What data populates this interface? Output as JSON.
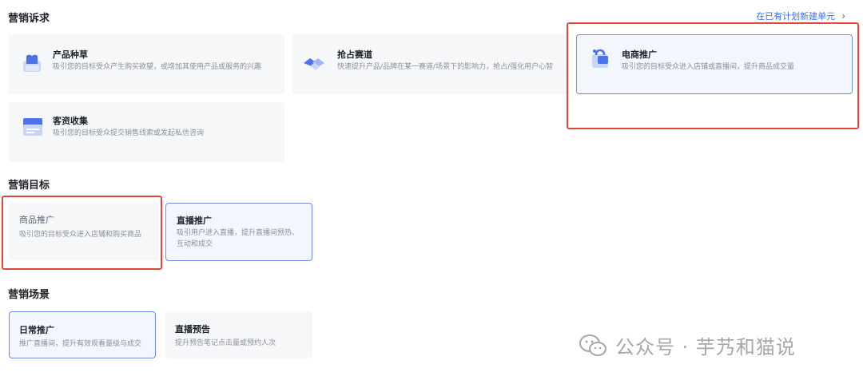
{
  "header": {
    "appeal_title": "营销诉求",
    "new_unit_link": "在已有计划新建单元",
    "chevron": "›"
  },
  "appeal_cards": [
    {
      "title": "产品种草",
      "desc": "吸引您的目标受众产生购买欲望，或增加其使用产品或服务的兴趣",
      "icon": "box-icon"
    },
    {
      "title": "抢占赛道",
      "desc": "快速提升产品/品牌在某一赛道/场景下的影响力，抢占/强化用户心智",
      "icon": "handshake-icon"
    },
    {
      "title": "电商推广",
      "desc": "吸引您的目标受众进入店铺或直播间，提升商品成交量",
      "icon": "shopping-bag-icon",
      "selected": true
    },
    {
      "title": "客资收集",
      "desc": "吸引您的目标受众提交销售线索或发起私信咨询",
      "icon": "form-icon"
    }
  ],
  "goal": {
    "title": "营销目标",
    "cards": [
      {
        "title": "商品推广",
        "desc": "吸引您的目标受众进入店铺和购买商品"
      },
      {
        "title": "直播推广",
        "desc": "吸引用户进入直播，提升直播间预热、互动和成交",
        "selected": true
      }
    ]
  },
  "scene": {
    "title": "营销场景",
    "cards": [
      {
        "title": "日常推广",
        "desc": "推广直播间，提升有效观看量级与成交",
        "selected": true
      },
      {
        "title": "直播预告",
        "desc": "提升预告笔记点击量或预约人次"
      }
    ]
  },
  "watermark": {
    "text": "公众号 · 芋艿和猫说",
    "icon": "wechat-icon"
  },
  "colors": {
    "accent": "#3a6fe8",
    "selected_border": "#6f8be6",
    "highlight": "#e0473a"
  }
}
